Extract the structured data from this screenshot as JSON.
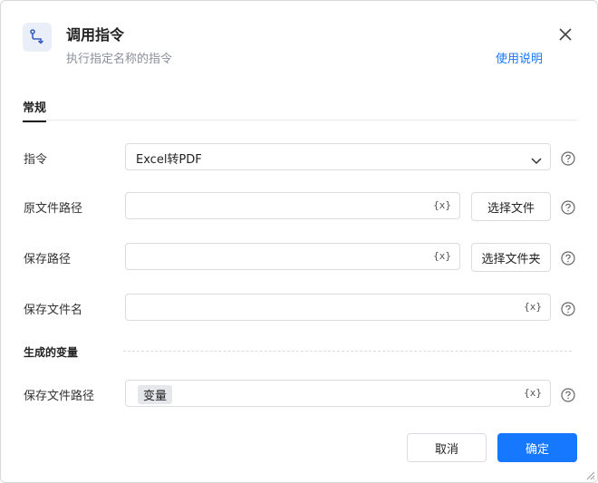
{
  "header": {
    "title": "调用指令",
    "subtitle": "执行指定名称的指令",
    "help_link": "使用说明"
  },
  "tabs": [
    {
      "label": "常规",
      "active": true
    }
  ],
  "form": {
    "command": {
      "label": "指令",
      "value": "Excel转PDF"
    },
    "source_path": {
      "label": "原文件路径",
      "value": "",
      "var_icon": "{x}",
      "button": "选择文件"
    },
    "save_path": {
      "label": "保存路径",
      "value": "",
      "var_icon": "{x}",
      "button": "选择文件夹"
    },
    "save_filename": {
      "label": "保存文件名",
      "value": "",
      "var_icon": "{x}"
    }
  },
  "output": {
    "section_title": "生成的变量",
    "saved_file_path": {
      "label": "保存文件路径",
      "chip": "变量",
      "var_icon": "{x}"
    }
  },
  "footer": {
    "cancel": "取消",
    "ok": "确定"
  },
  "colors": {
    "accent": "#1677ff",
    "border": "#d9dce1",
    "muted": "#8a8f99"
  }
}
